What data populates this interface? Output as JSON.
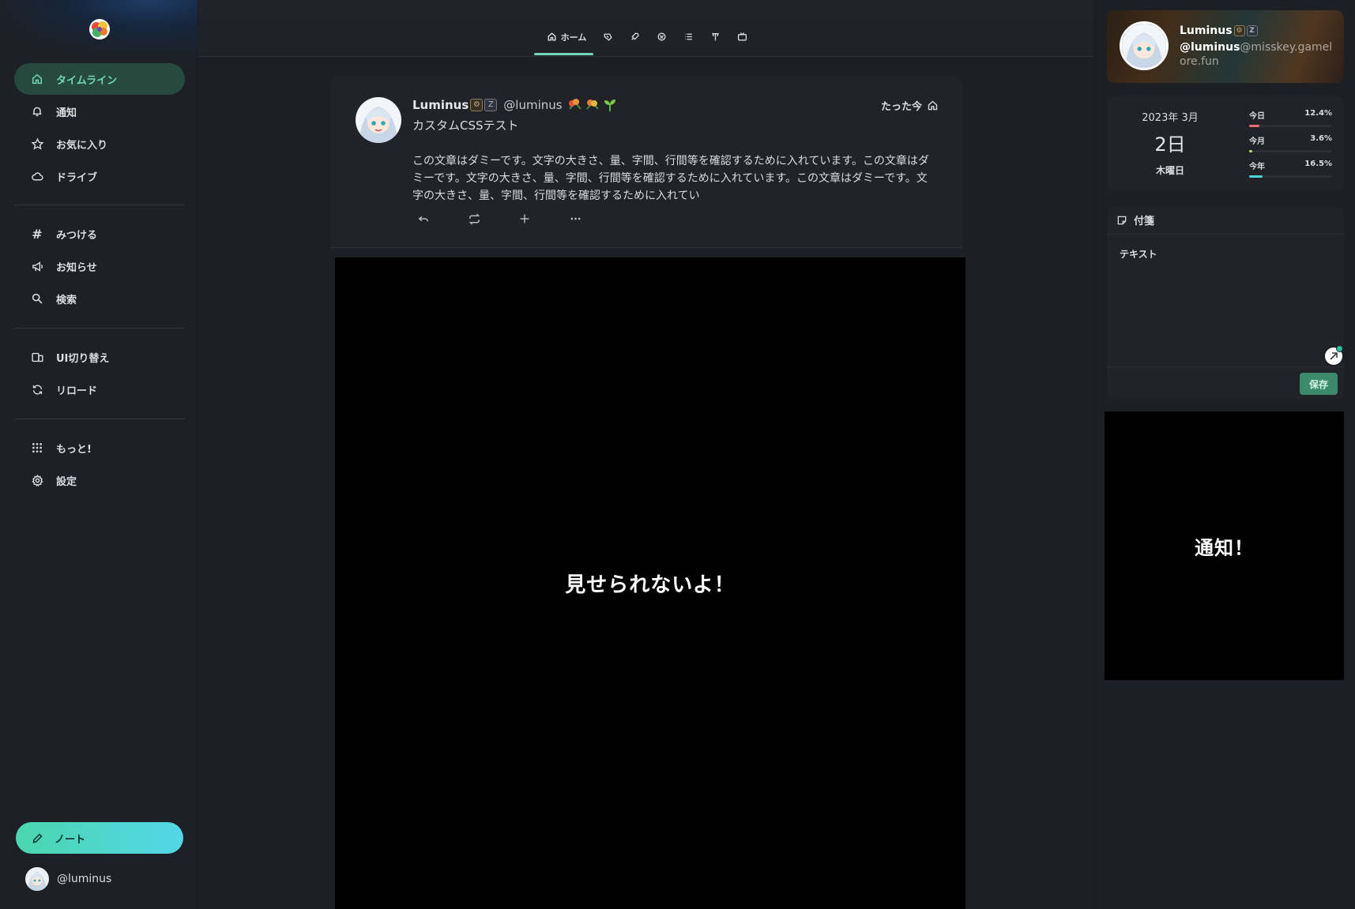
{
  "sidebar": {
    "items": [
      {
        "label": "タイムライン",
        "icon": "home-icon",
        "active": true
      },
      {
        "label": "通知",
        "icon": "bell-icon"
      },
      {
        "label": "お気に入り",
        "icon": "star-icon"
      },
      {
        "label": "ドライブ",
        "icon": "cloud-icon"
      },
      {
        "label": "みつける",
        "icon": "hashtag-icon"
      },
      {
        "label": "お知らせ",
        "icon": "speakerphone-icon"
      },
      {
        "label": "検索",
        "icon": "search-icon"
      },
      {
        "label": "UI切り替え",
        "icon": "device-switch-icon"
      },
      {
        "label": "リロード",
        "icon": "refresh-icon"
      },
      {
        "label": "もっと!",
        "icon": "grid-dots-icon"
      },
      {
        "label": "設定",
        "icon": "gear-icon"
      }
    ],
    "note_button": "ノート",
    "account_handle": "@luminus"
  },
  "tabs": {
    "home_label": "ホーム",
    "icons": [
      "home-icon",
      "local-icon",
      "rocket-icon",
      "global-icon",
      "list-icon",
      "antenna-icon",
      "channel-icon"
    ]
  },
  "note": {
    "name": "Luminus",
    "username": "@luminus",
    "time": "たった今",
    "cw": "カスタムCSSテスト",
    "body": "この文章はダミーです。文字の大きさ、量、字間、行間等を確認するために入れています。この文章はダミーです。文字の大きさ、量、字間、行間等を確認するために入れています。この文章はダミーです。文字の大きさ、量、字間、行間等を確認するために入れてい"
  },
  "blocked_text": "見せられないよ！",
  "profile": {
    "name": "Luminus",
    "handle_user": "@luminus",
    "handle_host": "@misskey.gamelore.fun"
  },
  "calendar": {
    "year_month": "2023年 3月",
    "day": "2日",
    "weekday": "木曜日",
    "stats": [
      {
        "label": "今日",
        "value": "12.4%",
        "fraction": 0.124,
        "color": "#e56f6f"
      },
      {
        "label": "今月",
        "value": "3.6%",
        "fraction": 0.036,
        "color": "#b7e06a"
      },
      {
        "label": "今年",
        "value": "16.5%",
        "fraction": 0.165,
        "color": "#4ed2d8"
      }
    ]
  },
  "sticky": {
    "title": "付箋",
    "text": "テキスト",
    "save_label": "保存"
  },
  "notify_text": "通知！"
}
